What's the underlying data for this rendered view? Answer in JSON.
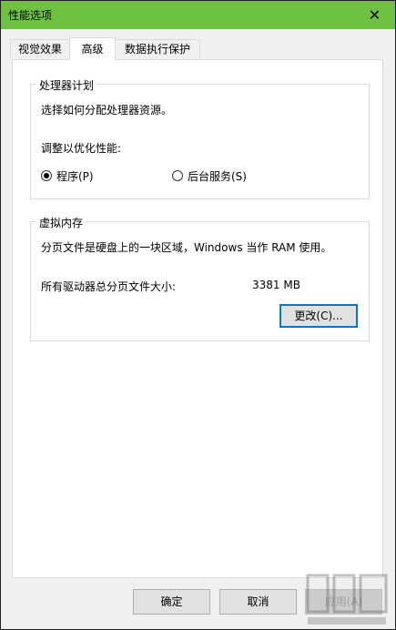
{
  "window": {
    "title": "性能选项",
    "close_glyph": "✕"
  },
  "tabs": [
    {
      "label": "视觉效果",
      "active": false
    },
    {
      "label": "高级",
      "active": true
    },
    {
      "label": "数据执行保护",
      "active": false
    }
  ],
  "processor": {
    "legend": "处理器计划",
    "description": "选择如何分配处理器资源。",
    "adjust_label": "调整以优化性能:",
    "options": [
      {
        "label": "程序(P)",
        "checked": true
      },
      {
        "label": "后台服务(S)",
        "checked": false
      }
    ]
  },
  "virtual_memory": {
    "legend": "虚拟内存",
    "description": "分页文件是硬盘上的一块区域，Windows 当作 RAM 使用。",
    "total_label": "所有驱动器总分页文件大小:",
    "total_value": "3381 MB",
    "change_button": "更改(C)..."
  },
  "footer": {
    "ok": "确定",
    "cancel": "取消",
    "apply": "应用(A)"
  },
  "accent_color": "#6fc142"
}
